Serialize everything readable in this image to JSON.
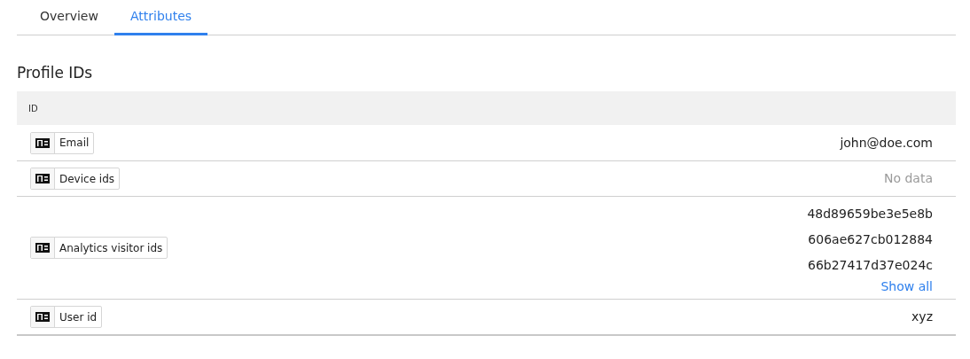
{
  "tabs": [
    {
      "label": "Overview",
      "selected": false
    },
    {
      "label": "Attributes",
      "selected": true
    }
  ],
  "section_title": "Profile IDs",
  "table": {
    "columns": [
      "ID"
    ],
    "rows": [
      {
        "label": "Email",
        "values": [
          {
            "text": "john@doe.com",
            "kind": "value"
          }
        ]
      },
      {
        "label": "Device ids",
        "values": [
          {
            "text": "No data",
            "kind": "empty"
          }
        ]
      },
      {
        "label": "Analytics visitor ids",
        "values": [
          {
            "text": "48d89659be3e5e8b",
            "kind": "value"
          },
          {
            "text": "606ae627cb012884",
            "kind": "value"
          },
          {
            "text": "66b27417d37e024c",
            "kind": "value"
          },
          {
            "text": "Show all",
            "kind": "link"
          }
        ]
      },
      {
        "label": "User id",
        "values": [
          {
            "text": "xyz",
            "kind": "value"
          }
        ]
      }
    ]
  }
}
